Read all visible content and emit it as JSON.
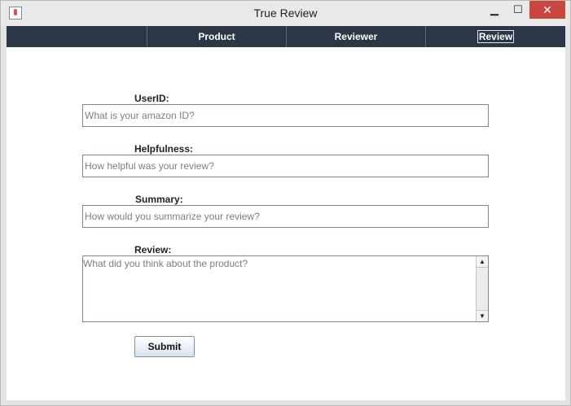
{
  "window": {
    "title": "True Review",
    "controls": {
      "minimize": "▁",
      "maximize": "☐",
      "close": "✕"
    }
  },
  "tabs": [
    {
      "label": "Product",
      "selected": false
    },
    {
      "label": "Reviewer",
      "selected": false
    },
    {
      "label": "Review",
      "selected": true
    }
  ],
  "form": {
    "userid": {
      "label": "UserID:",
      "placeholder": "What is your amazon ID?",
      "value": ""
    },
    "helpfulness": {
      "label": "Helpfulness:",
      "placeholder": "How helpful was your review?",
      "value": ""
    },
    "summary": {
      "label": "Summary:",
      "placeholder": "How would you summarize your review?",
      "value": ""
    },
    "review": {
      "label": "Review:",
      "placeholder": "What did you think about the product?",
      "value": ""
    },
    "submit_label": "Submit"
  },
  "icons": {
    "app": "java-cup-icon",
    "scroll_up": "arrow-up-icon",
    "scroll_down": "arrow-down-icon"
  },
  "colors": {
    "tabbar": "#2b3646",
    "close_button": "#c7463e"
  }
}
